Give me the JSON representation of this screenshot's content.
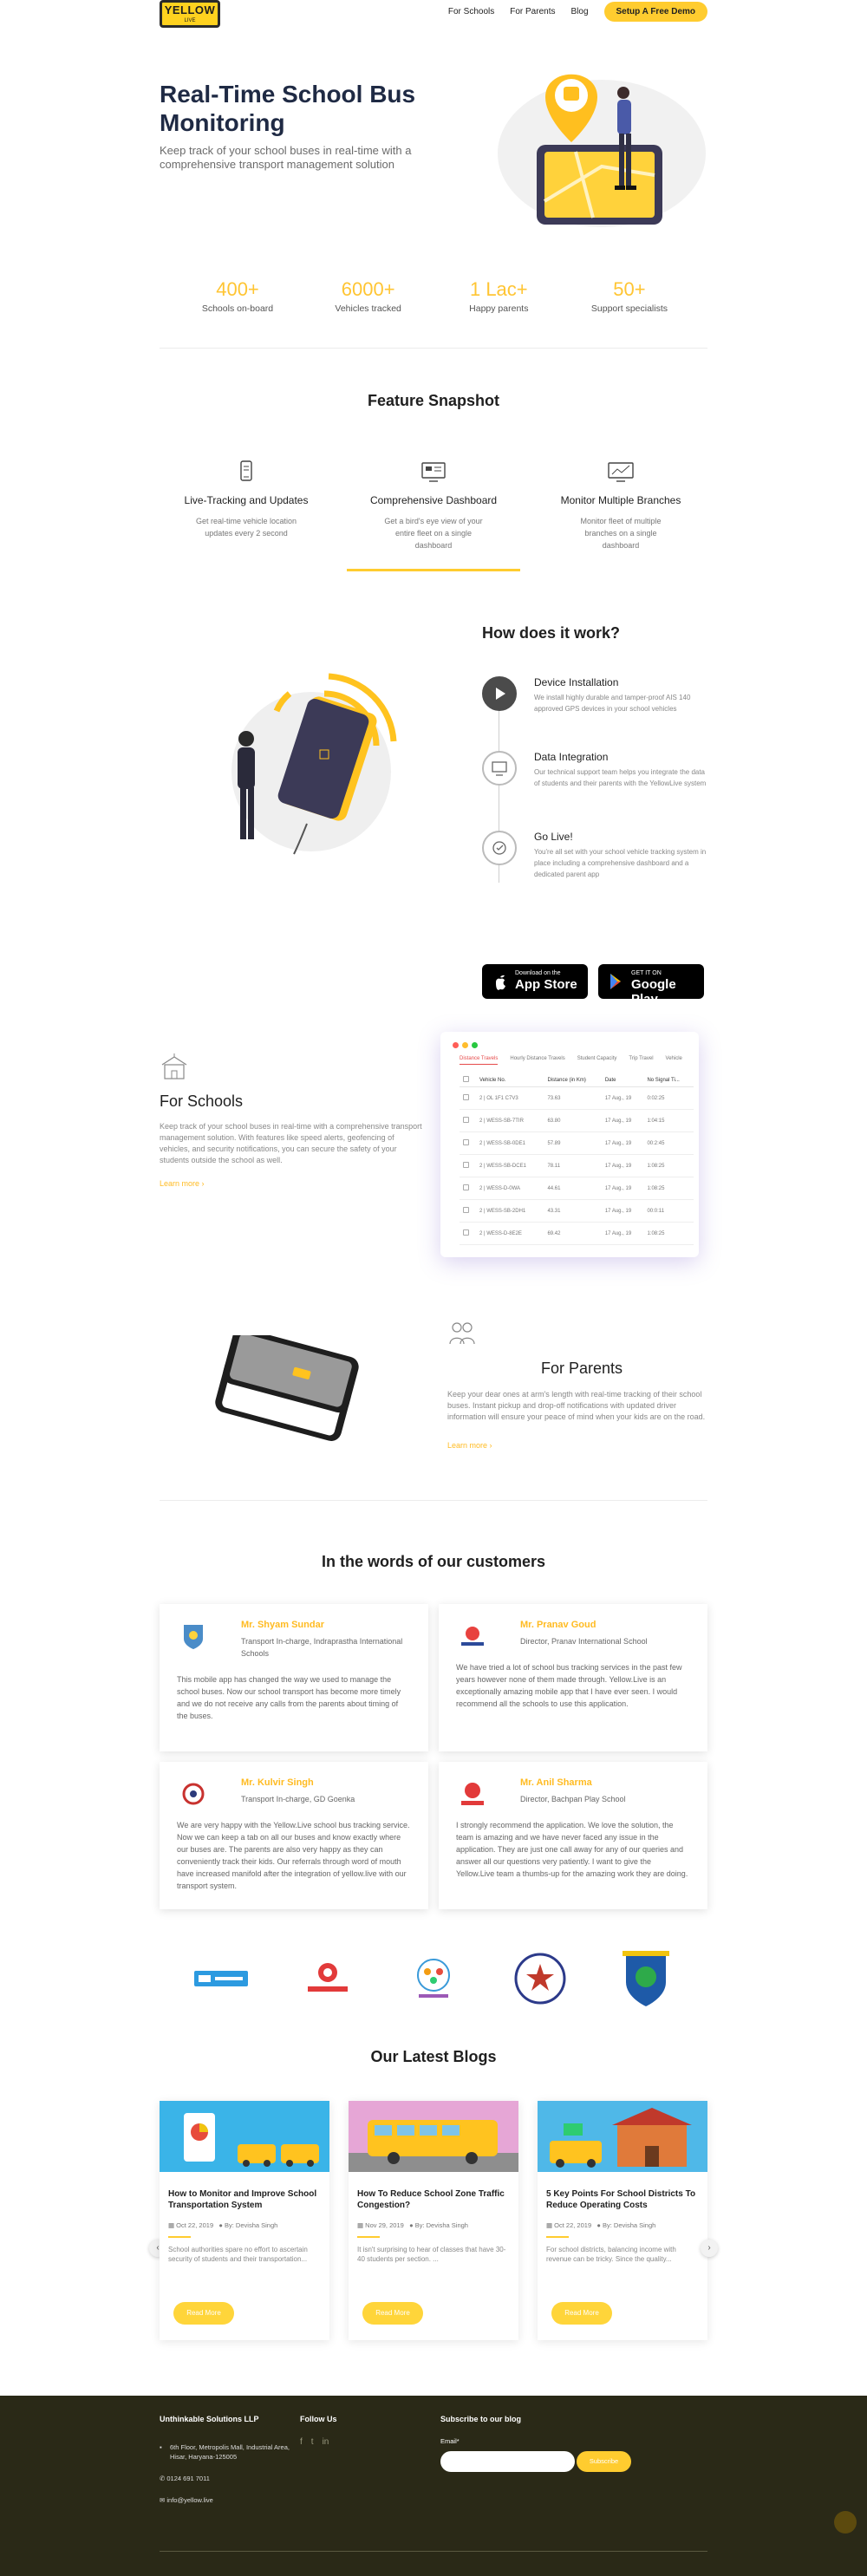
{
  "header": {
    "logo_top": "YELLOW",
    "logo_bottom": "LIVE",
    "nav": [
      "For Schools",
      "For Parents",
      "Blog"
    ],
    "cta": "Setup A Free Demo"
  },
  "hero": {
    "title": "Real-Time School Bus Monitoring",
    "subtitle": "Keep track of your school buses in real-time with a comprehensive transport management solution"
  },
  "stats": [
    {
      "num": "400+",
      "label": "Schools on-board"
    },
    {
      "num": "6000+",
      "label": "Vehicles tracked"
    },
    {
      "num": "1 Lac+",
      "label": "Happy parents"
    },
    {
      "num": "50+",
      "label": "Support specialists"
    }
  ],
  "features": {
    "title": "Feature Snapshot",
    "items": [
      {
        "title": "Live-Tracking and Updates",
        "text": "Get real-time vehicle location updates every 2 second",
        "icon": "phone-icon"
      },
      {
        "title": "Comprehensive Dashboard",
        "text": "Get a bird's eye view of your entire fleet on a single dashboard",
        "icon": "dashboard-icon"
      },
      {
        "title": "Monitor Multiple Branches",
        "text": "Monitor fleet of multiple branches on a single dashboard",
        "icon": "monitor-icon"
      }
    ]
  },
  "how": {
    "title": "How does it work?",
    "steps": [
      {
        "title": "Device Installation",
        "text": "We install highly durable and tamper-proof AIS 140 approved GPS devices in your school vehicles"
      },
      {
        "title": "Data Integration",
        "text": "Our technical support team helps you integrate the data of students and their parents with the YellowLive system"
      },
      {
        "title": "Go Live!",
        "text": "You're all set with your school vehicle tracking system in place including a comprehensive dashboard and a dedicated parent app"
      }
    ],
    "appstore_small": "Download on the",
    "appstore_big": "App Store",
    "play_small": "GET IT ON",
    "play_big": "Google Play"
  },
  "schools": {
    "title": "For Schools",
    "text": "Keep track of your school buses in real-time with a comprehensive transport management solution. With features like speed alerts, geofencing of vehicles, and security notifications, you can secure the safety of your students outside the school as well.",
    "more": "Learn more  ›",
    "tabs": [
      "Distance Travels",
      "Hourly Distance Travels",
      "Student Capacity",
      "Trip Travel",
      "Vehicle"
    ],
    "columns": [
      "",
      "Vehicle No.",
      "Distance (in Km)",
      "Date",
      "No Signal Ti..."
    ],
    "rows": [
      [
        "",
        "2 | OL 1F1 C7V3",
        "73.63",
        "17 Aug., 19",
        "0:02:25"
      ],
      [
        "",
        "2 | WESS-SB-7TIR",
        "63.80",
        "17 Aug., 19",
        "1:04:15"
      ],
      [
        "",
        "2 | WESS-SB-0DE1",
        "57.89",
        "17 Aug., 19",
        "00:2:45"
      ],
      [
        "",
        "2 | WESS-SB-DCE1",
        "78.11",
        "17 Aug., 19",
        "1:08:25"
      ],
      [
        "",
        "2 | WESS-D-0WA",
        "44.61",
        "17 Aug., 19",
        "1:08:25"
      ],
      [
        "",
        "2 | WESS-SB-2DH1",
        "43.31",
        "17 Aug., 19",
        "00:0:11"
      ],
      [
        "",
        "2 | WESS-D-8E2E",
        "69.42",
        "17 Aug., 19",
        "1:08:25"
      ]
    ]
  },
  "parents": {
    "title": "For Parents",
    "text": "Keep your dear ones at arm's length with real-time tracking of their school buses. Instant pickup and drop-off notifications with updated driver information will ensure your peace of mind when your kids are on the road.",
    "more": "Learn more  ›"
  },
  "testimonials": {
    "title": "In the words of our customers",
    "items": [
      {
        "name": "Mr. Shyam Sundar",
        "role": "Transport In-charge, Indraprastha International Schools",
        "quote": "This mobile app has changed the way we used to manage the school buses. Now our school transport has become more timely and we do not receive any calls from the parents about timing of the buses."
      },
      {
        "name": "Mr. Pranav Goud",
        "role": "Director, Pranav International School",
        "quote": "We have tried a lot of school bus tracking services in the past few years however none of them made through. Yellow.Live is an exceptionally amazing mobile app that I have ever seen. I would recommend all the schools to use this application."
      },
      {
        "name": "Mr. Kulvir Singh",
        "role": "Transport In-charge, GD Goenka",
        "quote": "We are very happy with the Yellow.Live school bus tracking service. Now we can keep a tab on all our buses and know exactly where our buses are. The parents are also very happy as they can conveniently track their kids. Our referrals through word of mouth have increased manifold after the integration of yellow.live with our transport system."
      },
      {
        "name": "Mr. Anil Sharma",
        "role": "Director, Bachpan Play School",
        "quote": "I strongly recommend the application. We love the solution, the team is amazing and we have never faced any issue in the application. They are just one call away for any of our queries and answer all our questions very patiently. I want to give the Yellow.Live team a thumbs-up for the amazing work they are doing."
      }
    ]
  },
  "partners": [
    "AA Academy",
    "Bachpan",
    "Sparkling Minds",
    "Meridian",
    "Modern School"
  ],
  "blogs": {
    "title": "Our Latest Blogs",
    "read_more": "Read More",
    "items": [
      {
        "title": "How to Monitor and Improve School Transportation System",
        "date": "Oct 22, 2019",
        "author": "By: Devisha Singh",
        "excerpt": "School authorities spare no effort to ascertain security of students and their transportation..."
      },
      {
        "title": "How To Reduce School Zone Traffic Congestion?",
        "date": "Nov 29, 2019",
        "author": "By: Devisha Singh",
        "excerpt": "It isn't surprising to hear of classes that have 30-40 students per section. ..."
      },
      {
        "title": "5 Key Points For School Districts To Reduce Operating Costs",
        "date": "Oct 22, 2019",
        "author": "By: Devisha Singh",
        "excerpt": "For school districts, balancing income with revenue can be tricky. Since the quality..."
      }
    ]
  },
  "footer": {
    "company": "Unthinkable Solutions LLP",
    "address": "6th Floor, Metropolis Mall, Industrial Area, Hisar, Haryana-125005",
    "phone": "0124 691 7011",
    "email": "info@yellow.live",
    "follow": "Follow Us",
    "subscribe": "Subscribe to our blog",
    "email_label": "Email*",
    "subscribe_btn": "Subscribe"
  }
}
